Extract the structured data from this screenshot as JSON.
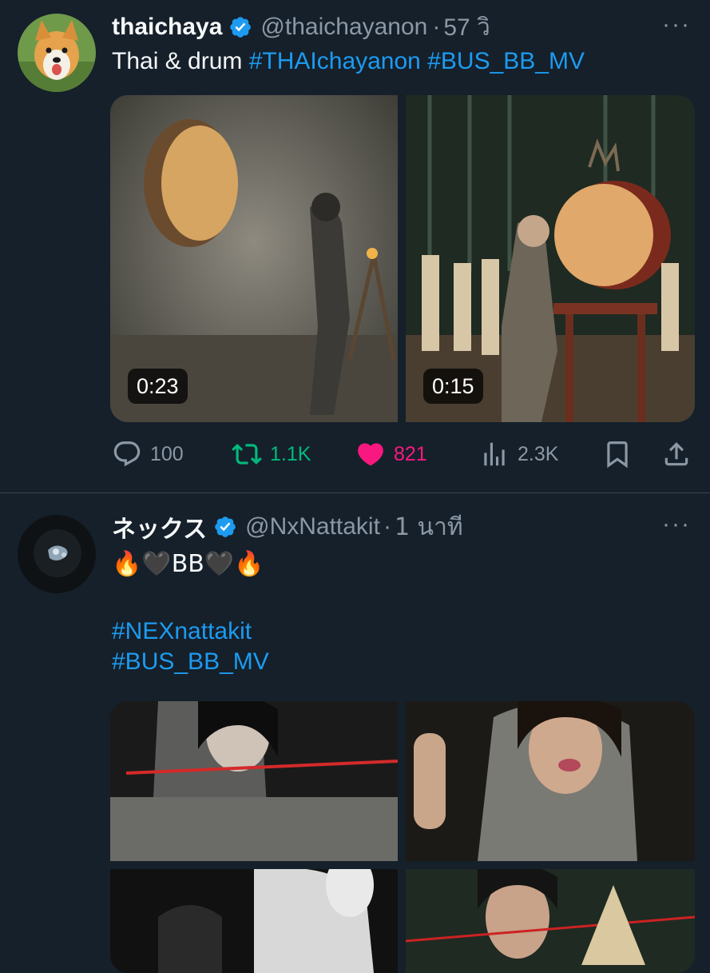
{
  "tweets": [
    {
      "display_name": "thaichaya",
      "handle": "@thaichayanon",
      "separator": "·",
      "time": "57 วิ",
      "more": "···",
      "text_plain": "Thai & drum ",
      "hashtags": [
        "#THAIchayanon",
        "#BUS_BB_MV"
      ],
      "media": [
        {
          "kind": "video",
          "duration": "0:23"
        },
        {
          "kind": "video",
          "duration": "0:15"
        }
      ],
      "stats": {
        "replies": "100",
        "reposts": "1.1K",
        "likes": "821",
        "views": "2.3K"
      },
      "liked": true,
      "reposted": true
    },
    {
      "display_name": "ネックス",
      "handle": "@NxNattakit",
      "separator": "·",
      "time": "1 นาที",
      "more": "···",
      "text_line1": "🔥🖤BB🖤🔥",
      "hashtags": [
        "#NEXnattakit",
        "#BUS_BB_MV"
      ],
      "media": [
        {
          "kind": "photo"
        },
        {
          "kind": "photo"
        },
        {
          "kind": "photo"
        },
        {
          "kind": "photo"
        }
      ]
    }
  ],
  "colors": {
    "background": "#15202b",
    "accent": "#1d9bf0",
    "like": "#f91880",
    "repost": "#00ba7c",
    "muted": "#8b98a5"
  },
  "icons": [
    "reply-icon",
    "repost-icon",
    "like-icon",
    "views-icon",
    "bookmark-icon",
    "share-icon",
    "verified-icon"
  ]
}
